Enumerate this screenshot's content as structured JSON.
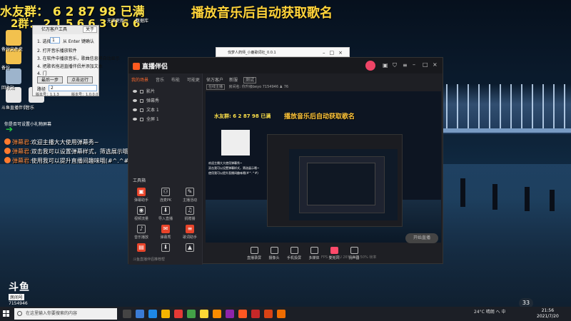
{
  "overlay": {
    "qq_group_line": "水友群：  6 2 87 98 已满",
    "group2_line": "2群：  2 1 5 6 6 3 0 6 6",
    "title": "播放音乐后自动获取歌名"
  },
  "desktop": {
    "label_1": "备份文件夹",
    "label_2": "备份",
    "label_3": "回收站",
    "label_4": "斗鱼直播伴侣",
    "label_5": "音乐",
    "label_6": "无法更新...",
    "label_7": "数据库"
  },
  "tool_dialog": {
    "title": "亿万客户工具",
    "close_label": "关于",
    "step1_prefix": "1. 选择",
    "step1_value": "1",
    "step1_suffix": "从 Enter 键确认",
    "step2": "2. 打开音乐播放软件",
    "step3": "3. 在软件中播放音乐，歌曲信息将自动显示",
    "step4": "4. 把歌名拖进直播伴侣并添加文本",
    "step5_label": "4. 门",
    "start_button": "最后一步",
    "reset_button": "点击运行",
    "status_label": "路径",
    "status_value": "2",
    "version_left": "版本号：1.1.3",
    "version_right": "版本号：1.0.0.0"
  },
  "chat": {
    "hint": "你是否可设置小礼物屏幕",
    "messages": [
      {
        "user": "弹幕君:",
        "text": "欢迎主播大大使用弹幕秀~"
      },
      {
        "user": "弹幕君:",
        "text": "双击我可以设置弹幕样式，筛选展示哦~"
      },
      {
        "user": "弹幕君:",
        "text": "使用我可以提升直播间趣味哦(#^.^#)"
      }
    ]
  },
  "douyu": {
    "logo": "斗鱼",
    "sub": "房间号",
    "room_id": "7154946"
  },
  "mini_window": {
    "title": "伐梦人药师_小鹿歌词社_0.0.1"
  },
  "app": {
    "logo": "直播伴侣",
    "left_tabs": [
      "我的场景",
      "音乐",
      "布能",
      "可能更"
    ],
    "sources": [
      "影片",
      "弹幕秀",
      "文本 1",
      "全屏 1"
    ],
    "tools_title": "工具箱",
    "tools": [
      {
        "label": "弹幕助手",
        "icon": "▣",
        "hot": true
      },
      {
        "label": "连麦PK",
        "icon": "⚇",
        "hot": false
      },
      {
        "label": "主播活动",
        "icon": "✎",
        "hot": false
      },
      {
        "label": "视频流量",
        "icon": "◉",
        "hot": false
      },
      {
        "label": "导入直播",
        "icon": "⬇",
        "hot": false
      },
      {
        "label": "捐赠播",
        "icon": "♫",
        "hot": false
      },
      {
        "label": "音乐播放",
        "icon": "♪",
        "hot": false
      },
      {
        "label": "弹幕秀",
        "icon": "✉",
        "hot": true
      },
      {
        "label": "歌词助手",
        "icon": "≡",
        "hot": true
      },
      {
        "label": "",
        "icon": "▤",
        "hot": true
      },
      {
        "label": "",
        "icon": "⬇",
        "hot": false
      },
      {
        "label": "",
        "icon": "▲",
        "hot": false
      }
    ],
    "left_footer": "斗鱼直播伴侣推荐帮",
    "mid_tabs": [
      "亿万客户",
      "新服",
      "测试"
    ],
    "mid_info_btn": "在线主播",
    "mid_info_text": "房间名: 你升级beyo   7154946",
    "mid_info_count": "76",
    "preview_top": "水友群: 6 2 87 98 已满",
    "preview_title": "播放音乐后自动获取歌名",
    "bottom_items": [
      "直播录屏",
      "摄像头",
      "手机投屏",
      "多媒体",
      "麦克风",
      "扬声器"
    ],
    "start_label": "开始直播",
    "status_text": "FPS 30   CPU 26%   内存 50%   帧率"
  },
  "taskbar": {
    "search_placeholder": "在这里输入你要搜索的内容",
    "tray_text": "24°C 晴朗  へ  中",
    "time": "21:56",
    "date": "2021/7/20",
    "badge": "33"
  },
  "colors": {
    "accent_orange": "#ff6a2e",
    "overlay_yellow": "#ffe24a"
  }
}
